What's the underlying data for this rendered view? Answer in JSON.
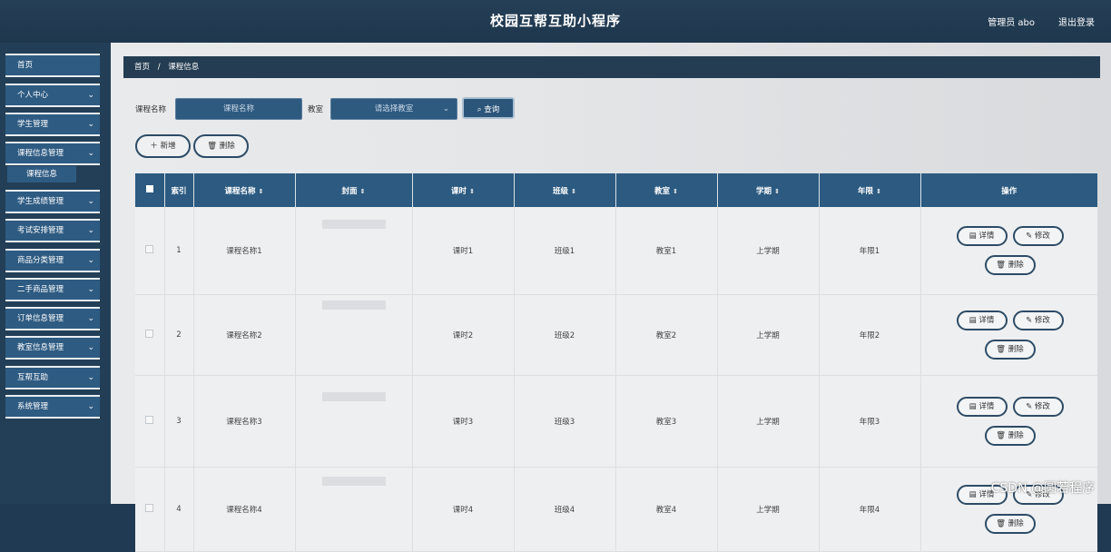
{
  "header": {
    "title": "校园互帮互助小程序",
    "admin": "管理员 abo",
    "logout": "退出登录"
  },
  "sidebar": {
    "items": [
      {
        "label": "首页",
        "chevron": ""
      },
      {
        "label": "个人中心",
        "chevron": "⌄"
      },
      {
        "label": "学生管理",
        "chevron": "⌄"
      },
      {
        "label": "课程信息管理",
        "chevron": "⌄"
      },
      {
        "label": "学生成绩管理",
        "chevron": "⌄"
      },
      {
        "label": "考试安排管理",
        "chevron": "⌄"
      },
      {
        "label": "商品分类管理",
        "chevron": "⌄"
      },
      {
        "label": "二手商品管理",
        "chevron": "⌄"
      },
      {
        "label": "订单信息管理",
        "chevron": "⌄"
      },
      {
        "label": "教室信息管理",
        "chevron": "⌄"
      },
      {
        "label": "互帮互助",
        "chevron": "⌄"
      },
      {
        "label": "系统管理",
        "chevron": "⌄"
      }
    ],
    "sub_item": "课程信息"
  },
  "breadcrumb": {
    "home": "首页",
    "sep": "/",
    "current": "课程信息"
  },
  "search": {
    "name_label": "课程名称",
    "name_placeholder": "课程名称",
    "room_label": "教室",
    "room_placeholder": "请选择教室",
    "query": "查询"
  },
  "actions": {
    "add": "新增",
    "delete": "删除"
  },
  "table": {
    "columns": [
      "索引",
      "课程名称",
      "封面",
      "课时",
      "班级",
      "教室",
      "学期",
      "年限",
      "操作"
    ],
    "rows": [
      {
        "index": "1",
        "name": "课程名称1",
        "hours": "课时1",
        "class": "班级1",
        "room": "教室1",
        "term": "上学期",
        "year": "年限1"
      },
      {
        "index": "2",
        "name": "课程名称2",
        "hours": "课时2",
        "class": "班级2",
        "room": "教室2",
        "term": "上学期",
        "year": "年限2"
      },
      {
        "index": "3",
        "name": "课程名称3",
        "hours": "课时3",
        "class": "班级3",
        "room": "教室3",
        "term": "上学期",
        "year": "年限3"
      },
      {
        "index": "4",
        "name": "课程名称4",
        "hours": "课时4",
        "class": "班级4",
        "room": "教室4",
        "term": "上学期",
        "year": "年限4"
      }
    ],
    "row_actions": {
      "detail": "详情",
      "edit": "修改",
      "delete": "删除"
    }
  },
  "watermark": "CSDN @圆若程序"
}
